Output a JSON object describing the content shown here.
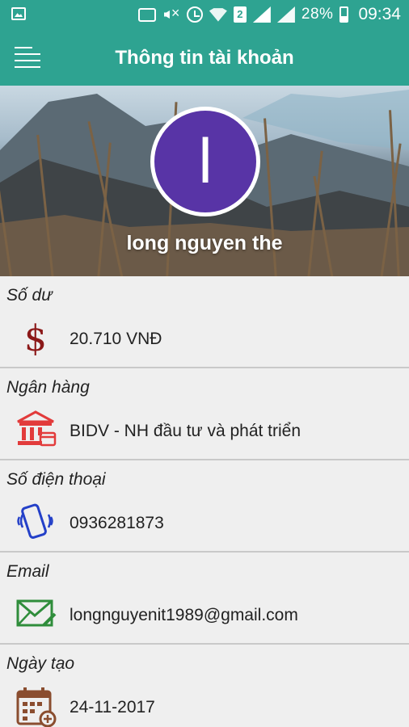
{
  "status_bar": {
    "battery_percent": "28%",
    "time": "09:34"
  },
  "app_bar": {
    "title": "Thông tin tài khoản"
  },
  "profile": {
    "avatar_initial": "l",
    "name": "long nguyen the",
    "avatar_color": "#5834a6"
  },
  "sections": [
    {
      "label": "Số dư",
      "value": "20.710 VNĐ",
      "icon": "dollar-icon",
      "icon_color": "#8b1818"
    },
    {
      "label": "Ngân hàng",
      "value": "BIDV - NH đầu tư và phát triển",
      "icon": "bank-icon",
      "icon_color": "#e23b3b"
    },
    {
      "label": "Số điện thoại",
      "value": "0936281873",
      "icon": "phone-vibrate-icon",
      "icon_color": "#2440c8"
    },
    {
      "label": "Email",
      "value": "longnguyenit1989@gmail.com",
      "icon": "email-icon",
      "icon_color": "#2f8d3b"
    },
    {
      "label": "Ngày tạo",
      "value": "24-11-2017",
      "icon": "calendar-add-icon",
      "icon_color": "#8a4d2f"
    }
  ],
  "colors": {
    "primary": "#2ea391"
  }
}
